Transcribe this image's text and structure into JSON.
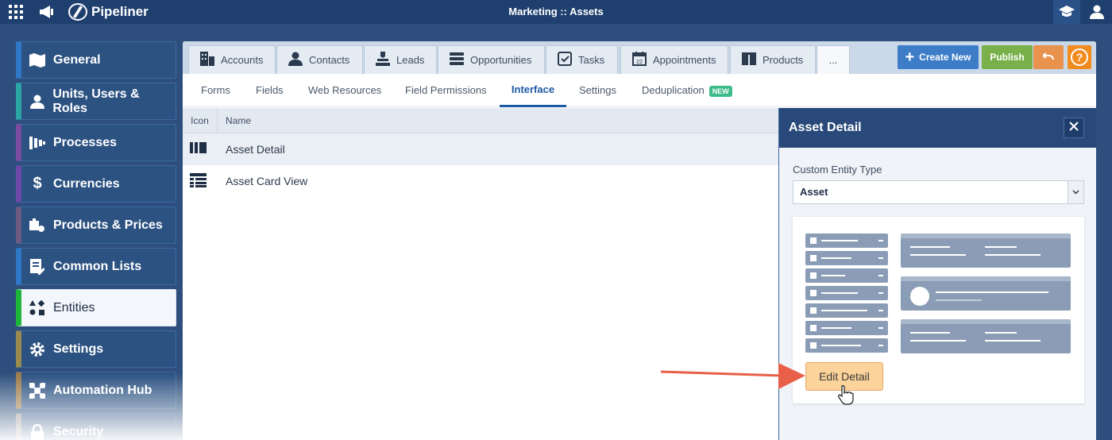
{
  "app": {
    "brand": "Pipeliner",
    "title": "Marketing :: Assets"
  },
  "sidebar": {
    "items": [
      {
        "label": "General",
        "icon": "map-icon",
        "accent": "#2f77c7"
      },
      {
        "label": "Units, Users & Roles",
        "icon": "user-icon",
        "accent": "#2aa7a5"
      },
      {
        "label": "Processes",
        "icon": "funnel-icon",
        "accent": "#7a4b9e"
      },
      {
        "label": "Currencies",
        "icon": "dollar-icon",
        "accent": "#6e48a8"
      },
      {
        "label": "Products & Prices",
        "icon": "products-icon",
        "accent": "#6b5b82"
      },
      {
        "label": "Common Lists",
        "icon": "list-edit-icon",
        "accent": "#2f77c7"
      },
      {
        "label": "Entities",
        "icon": "shapes-icon",
        "accent": "#1eb53a"
      },
      {
        "label": "Settings",
        "icon": "gear-icon",
        "accent": "#9a8a50"
      },
      {
        "label": "Automation Hub",
        "icon": "network-icon",
        "accent": "#9a7a4a"
      },
      {
        "label": "Security",
        "icon": "lock-icon",
        "accent": "#8a8a8a"
      }
    ]
  },
  "tabs": [
    {
      "label": "Accounts",
      "icon": "building-icon"
    },
    {
      "label": "Contacts",
      "icon": "contact-icon"
    },
    {
      "label": "Leads",
      "icon": "leads-icon"
    },
    {
      "label": "Opportunities",
      "icon": "opportunities-icon"
    },
    {
      "label": "Tasks",
      "icon": "task-check-icon"
    },
    {
      "label": "Appointments",
      "icon": "calendar-icon"
    },
    {
      "label": "Products",
      "icon": "products-icon"
    },
    {
      "label": "...",
      "icon": ""
    }
  ],
  "header_buttons": {
    "create_new": "Create New",
    "publish": "Publish",
    "help": "?"
  },
  "subtabs": {
    "items": [
      "Forms",
      "Fields",
      "Web Resources",
      "Field Permissions",
      "Interface",
      "Settings",
      "Deduplication"
    ],
    "active": "Interface",
    "new_badge": "NEW"
  },
  "table": {
    "columns": [
      "Icon",
      "Name"
    ],
    "rows": [
      {
        "name": "Asset Detail",
        "icon": "detail-columns-icon"
      },
      {
        "name": "Asset Card View",
        "icon": "card-view-icon"
      }
    ]
  },
  "panel": {
    "title": "Asset Detail",
    "field_label": "Custom Entity Type",
    "field_value": "Asset",
    "edit_button": "Edit Detail"
  },
  "colors": {
    "accent": "#1d5aa5",
    "create": "#3d7dc8",
    "publish": "#79b04a",
    "undo": "#e8924e",
    "help": "#f28b1e",
    "annotation": "#e8604a"
  }
}
